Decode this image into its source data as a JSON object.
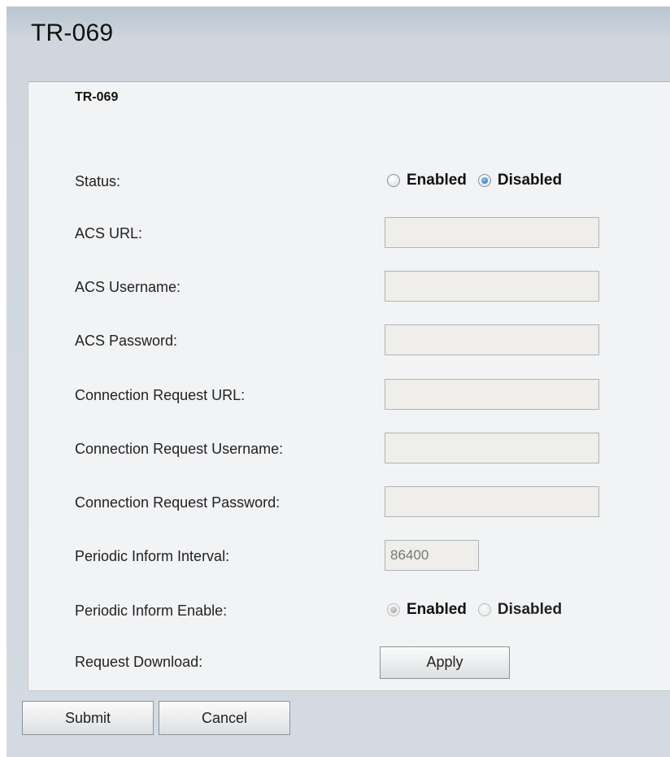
{
  "page": {
    "title": "TR-069"
  },
  "section": {
    "title": "TR-069"
  },
  "status": {
    "label": "Status:",
    "options": [
      "Enabled",
      "Disabled"
    ],
    "selected": "Disabled"
  },
  "fields": {
    "acs_url": {
      "label": "ACS URL:",
      "value": ""
    },
    "acs_username": {
      "label": "ACS Username:",
      "value": ""
    },
    "acs_password": {
      "label": "ACS Password:",
      "value": ""
    },
    "conn_req_url": {
      "label": "Connection Request URL:",
      "value": ""
    },
    "conn_req_username": {
      "label": "Connection Request Username:",
      "value": ""
    },
    "conn_req_password": {
      "label": "Connection Request Password:",
      "value": ""
    },
    "periodic_interval": {
      "label": "Periodic Inform Interval:",
      "value": "86400"
    }
  },
  "periodic_enable": {
    "label": "Periodic Inform Enable:",
    "options": [
      "Enabled",
      "Disabled"
    ],
    "selected": "Enabled",
    "disabled": true
  },
  "request_download": {
    "label": "Request Download:",
    "button": "Apply"
  },
  "footer": {
    "submit": "Submit",
    "cancel": "Cancel"
  },
  "colors": {
    "background": "#d3dae1",
    "panel": "#f2f3f5",
    "field": "#efeeea",
    "radio_selected": "#1f5fb3"
  }
}
